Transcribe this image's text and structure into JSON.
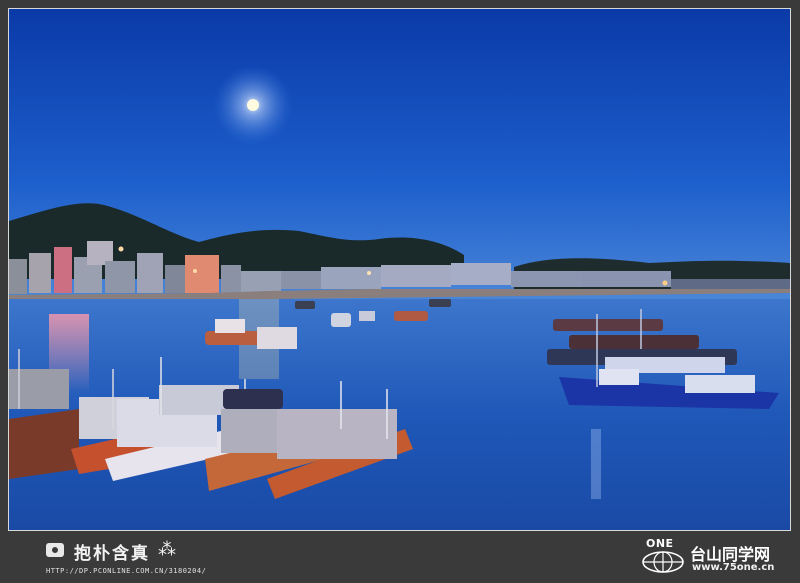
{
  "photo": {
    "subject": "",
    "colors": {
      "sky_top": "#0b3fb0",
      "sky_bottom": "#3f7fd6",
      "water": "#1f57b8",
      "hills": "#1c2a2a",
      "moon": "#fffbe0"
    }
  },
  "watermark_left": {
    "signature": "抱朴含真",
    "url": "HTTP://DP.PCONLINE.COM.CN/3180204/",
    "icon": "camera-icon"
  },
  "watermark_right": {
    "badge": "ONE",
    "title": "台山同学网",
    "url": "www.75one.cn",
    "icon": "globe-icon"
  }
}
